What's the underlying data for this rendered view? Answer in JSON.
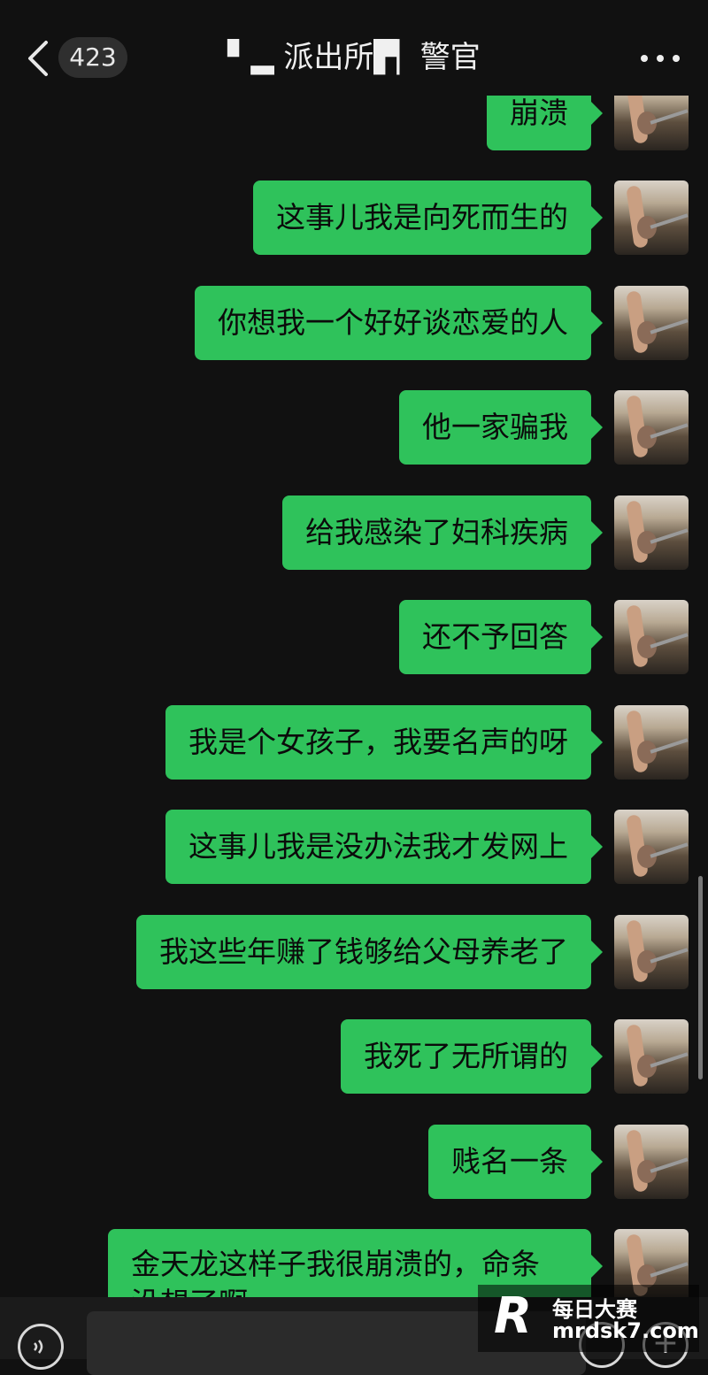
{
  "header": {
    "back_label": "<",
    "unread_count": "423",
    "title": "▘▂ 派出所▛▏警官",
    "more_label": "···"
  },
  "messages": [
    {
      "text": "崩溃",
      "side": "right"
    },
    {
      "text": "这事儿我是向死而生的",
      "side": "right"
    },
    {
      "text": "你想我一个好好谈恋爱的人",
      "side": "right"
    },
    {
      "text": "他一家骗我",
      "side": "right"
    },
    {
      "text": "给我感染了妇科疾病",
      "side": "right"
    },
    {
      "text": "还不予回答",
      "side": "right"
    },
    {
      "text": "我是个女孩子，我要名声的呀",
      "side": "right"
    },
    {
      "text": "这事儿我是没办法我才发网上",
      "side": "right"
    },
    {
      "text": "我这些年赚了钱够给父母养老了",
      "side": "right"
    },
    {
      "text": "我死了无所谓的",
      "side": "right"
    },
    {
      "text": "贱名一条",
      "side": "right"
    },
    {
      "text": "金天龙这样子我很崩溃的，命条没想了啊",
      "side": "right"
    }
  ],
  "bottom": {
    "voice_icon": "voice-icon",
    "input_placeholder": "",
    "emoji_icon": "emoji-icon",
    "plus_label": "+"
  },
  "watermark": {
    "logo": "R",
    "name": "每日大赛",
    "url": "mrdsk7.com"
  },
  "colors": {
    "background": "#111111",
    "bubble": "#2fc25b",
    "text_on_bubble": "#0b0b0b"
  }
}
